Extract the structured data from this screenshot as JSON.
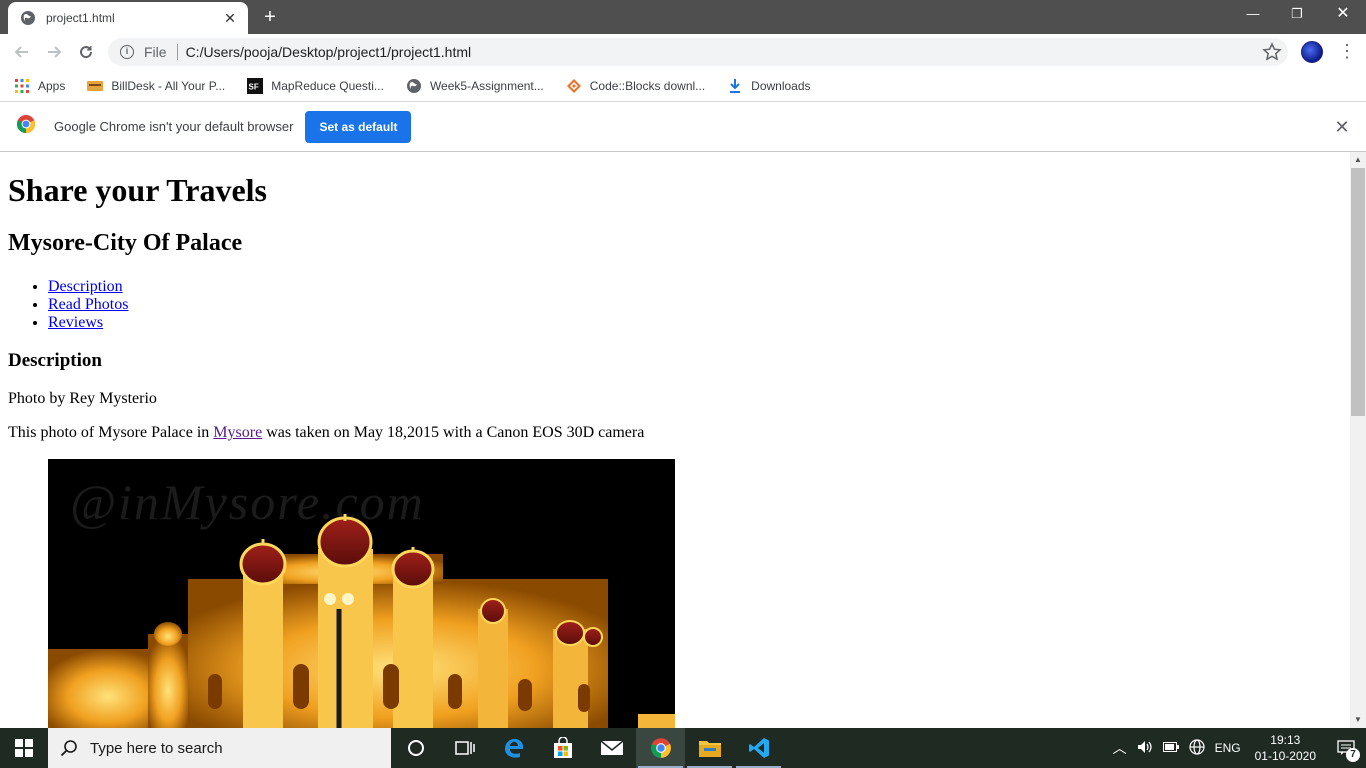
{
  "tab": {
    "title": "project1.html",
    "close": "✕",
    "new_tab": "+"
  },
  "window_controls": {
    "minimize": "—",
    "restore": "❐",
    "close": "✕"
  },
  "omnibox": {
    "scheme": "File",
    "url": "C:/Users/pooja/Desktop/project1/project1.html"
  },
  "bookmarks": [
    {
      "label": "Apps",
      "icon": "apps-grid-icon"
    },
    {
      "label": "BillDesk - All Your P...",
      "icon": "billdesk-icon"
    },
    {
      "label": "MapReduce Questi...",
      "icon": "sf-icon"
    },
    {
      "label": "Week5-Assignment...",
      "icon": "globe-icon"
    },
    {
      "label": "Code::Blocks downl...",
      "icon": "codeblocks-icon"
    },
    {
      "label": "Downloads",
      "icon": "download-icon"
    }
  ],
  "infobar": {
    "message": "Google Chrome isn't your default browser",
    "button": "Set as default"
  },
  "page": {
    "h1": "Share your Travels",
    "h2": "Mysore-City Of Palace",
    "nav_links": [
      "Description",
      "Read Photos",
      "Reviews"
    ],
    "h3": "Description",
    "photo_credit": "Photo by Rey Mysterio",
    "caption_before": "This photo of Mysore Palace in ",
    "caption_link": "Mysore",
    "caption_after": " was taken on May 18,2015 with a Canon EOS 30D camera",
    "photo_watermark": "@inMysore.com"
  },
  "taskbar": {
    "search_placeholder": "Type here to search",
    "language": "ENG",
    "time": "19:13",
    "date": "01-10-2020",
    "notification_count": "7"
  },
  "colors": {
    "accent": "#1a73e8",
    "link": "#0000ee",
    "visited_link": "#551a8b",
    "taskbar": "#1f2a23"
  }
}
